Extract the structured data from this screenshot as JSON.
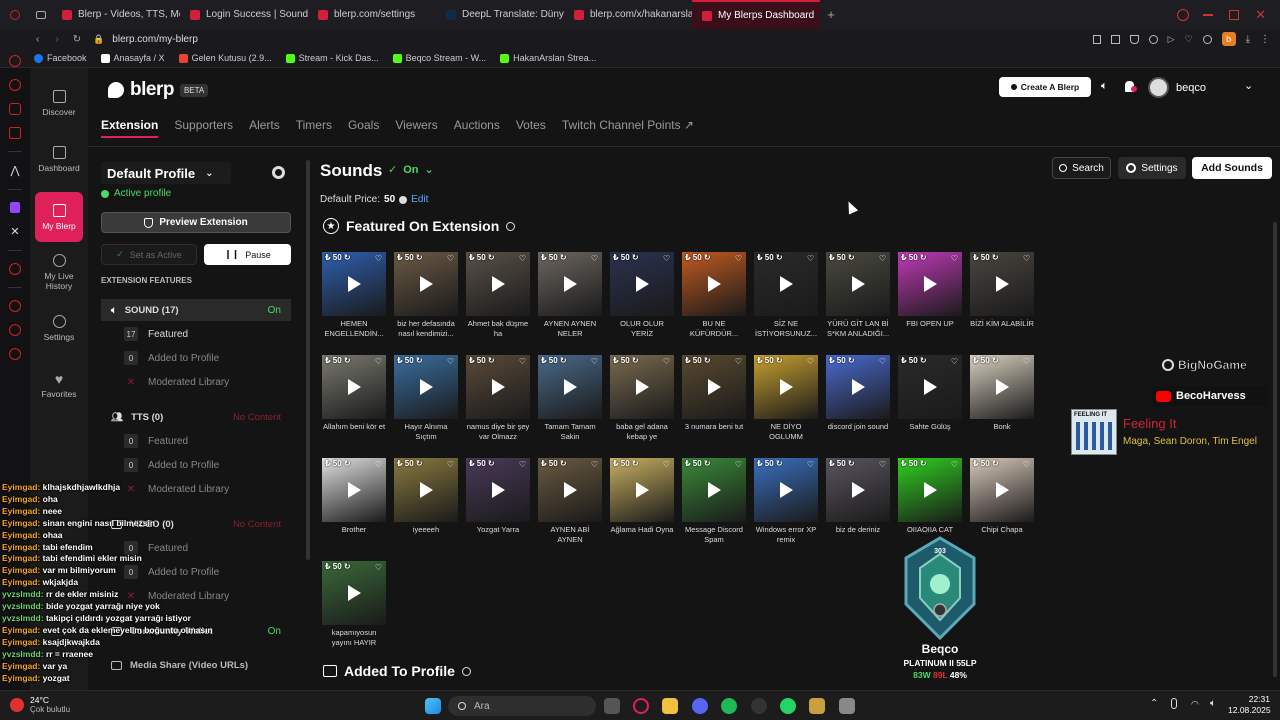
{
  "browser": {
    "tabs": [
      {
        "label": "Blerp - Videos, TTS, Mem",
        "color": "#d0203a"
      },
      {
        "label": "Login Success | Soundbo",
        "color": "#d0203a"
      },
      {
        "label": "blerp.com/settings",
        "color": "#d0203a"
      },
      {
        "label": "DeepL Translate: Dünyan",
        "color": "#0f2b46"
      },
      {
        "label": "blerp.com/x/hakanarslan",
        "color": "#d0203a"
      },
      {
        "label": "My Blerps Dashboard",
        "color": "#d0203a"
      }
    ],
    "url": "blerp.com/my-blerp",
    "bookmarks": [
      {
        "label": "Facebook",
        "color": "#1877f2"
      },
      {
        "label": "Anasayfa / X",
        "color": "#ffffff"
      },
      {
        "label": "Gelen Kutusu (2.9...",
        "color": "#ea4335"
      },
      {
        "label": "Stream - Kick Das...",
        "color": "#53fc18"
      },
      {
        "label": "Beqco Stream - W...",
        "color": "#53fc18"
      },
      {
        "label": "HakanArslan Strea...",
        "color": "#53fc18"
      }
    ]
  },
  "app": {
    "logo": "blerp",
    "beta": "BETA",
    "create_button": "Create A Blerp",
    "username": "beqco",
    "nav": [
      {
        "label": "Discover"
      },
      {
        "label": "Dashboard"
      },
      {
        "label": "My Blerp"
      },
      {
        "label": "My Live History"
      },
      {
        "label": "Settings"
      },
      {
        "label": "Favorites"
      }
    ],
    "tabs": [
      "Extension",
      "Supporters",
      "Alerts",
      "Timers",
      "Goals",
      "Viewers",
      "Auctions",
      "Votes",
      "Twitch Channel Points ↗"
    ]
  },
  "left_panel": {
    "profile": "Default Profile",
    "active_profile": "Active profile",
    "preview": "Preview Extension",
    "set_active": "Set as Active",
    "pause": "Pause",
    "features_heading": "EXTENSION FEATURES",
    "sound": {
      "label": "SOUND (17)",
      "status": "On",
      "featured_count": "17",
      "featured": "Featured",
      "added_count": "0",
      "added": "Added to Profile",
      "moderated": "Moderated Library"
    },
    "tts": {
      "label": "TTS (0)",
      "status": "No Content",
      "featured_count": "0",
      "featured": "Featured",
      "added_count": "0",
      "added": "Added to Profile",
      "moderated": "Moderated Library"
    },
    "video": {
      "label": "VIDEO (0)",
      "status": "No Content",
      "featured_count": "0",
      "featured": "Featured",
      "added_count": "0",
      "added": "Added to Profile",
      "moderated": "Moderated Library"
    },
    "wallet": {
      "label": "Community Wallet",
      "status": "On"
    },
    "media_share": "Media Share (Video URLs)"
  },
  "main": {
    "title": "Sounds",
    "status": "On",
    "default_price_label": "Default Price:",
    "default_price_value": "50",
    "edit": "Edit",
    "search": "Search",
    "settings": "Settings",
    "add_sounds": "Add Sounds",
    "featured_heading": "Featured On Extension",
    "added_heading": "Added To Profile",
    "tiles": [
      {
        "price": "50",
        "caption": "HEMEN ENGELLENDİN...",
        "color": "#2f5fb0"
      },
      {
        "price": "50",
        "caption": "biz her defasında nasıl kendimizi...",
        "color": "#6b5a45"
      },
      {
        "price": "50",
        "caption": "Ahmet bak düşme ha",
        "color": "#5a5148"
      },
      {
        "price": "50",
        "caption": "AYNEN AYNEN NELER YAPIYOR...",
        "color": "#6c6660"
      },
      {
        "price": "50",
        "caption": "OLUR OLUR YERİZ",
        "color": "#2a3250"
      },
      {
        "price": "50",
        "caption": "BU NE KÜFÜRDÜR...",
        "color": "#c25a20"
      },
      {
        "price": "50",
        "caption": "SİZ NE İSTİYORSUNUZ...",
        "color": "#2a2a2a"
      },
      {
        "price": "50",
        "caption": "YÜRÜ GİT LAN Bİ S*KM ANLADIĞI...",
        "color": "#4a4a40"
      },
      {
        "price": "50",
        "caption": "FBI OPEN UP",
        "color": "#c03ab8"
      },
      {
        "price": "50",
        "caption": "BİZİ KİM ALABİLİR",
        "color": "#4a4540"
      },
      {
        "price": "50",
        "caption": "Allahım beni kör et",
        "color": "#7a7a70"
      },
      {
        "price": "50",
        "caption": "Hayır Alnıma Sıçtım",
        "color": "#3a6fa0"
      },
      {
        "price": "50",
        "caption": "namus diye bir şey var Olmazz",
        "color": "#5a4a3a"
      },
      {
        "price": "50",
        "caption": "Tamam Tamam Sakin",
        "color": "#4a6a8a"
      },
      {
        "price": "50",
        "caption": "baba gel adana kebap ye",
        "color": "#7a6a50"
      },
      {
        "price": "50",
        "caption": "3 numara beni tut",
        "color": "#5a4a30"
      },
      {
        "price": "50",
        "caption": "NE DİYO OGLUMM",
        "color": "#c8a030"
      },
      {
        "price": "50",
        "caption": "discord join sound",
        "color": "#4a6ad0"
      },
      {
        "price": "50",
        "caption": "Sahte Gülüş",
        "color": "#2a2a2a"
      },
      {
        "price": "50",
        "caption": "Bonk",
        "color": "#d8d0c0"
      },
      {
        "price": "50",
        "caption": "Brother",
        "color": "#e0e0e0"
      },
      {
        "price": "50",
        "caption": "iyeeeeh",
        "color": "#8a7a40"
      },
      {
        "price": "50",
        "caption": "Yozgat Yarra",
        "color": "#4a3a5a"
      },
      {
        "price": "50",
        "caption": "AYNEN ABİ AYNEN",
        "color": "#6a5a40"
      },
      {
        "price": "50",
        "caption": "Ağlama Hadi Oyna",
        "color": "#c8b060"
      },
      {
        "price": "50",
        "caption": "Message Discord Spam",
        "color": "#3a8a3a"
      },
      {
        "price": "50",
        "caption": "Windows error XP remix",
        "color": "#3a70c0"
      },
      {
        "price": "50",
        "caption": "biz de deriniz",
        "color": "#5a5560"
      },
      {
        "price": "50",
        "caption": "OIIAOIIA CAT",
        "color": "#30d020"
      },
      {
        "price": "50",
        "caption": "Chipi Chapa",
        "color": "#d8c8b8"
      },
      {
        "price": "50",
        "caption": "kapamıyosun yayını HAYIR",
        "color": "#3a6a3a"
      }
    ]
  },
  "overlay": {
    "channel1": "BigNoGame",
    "channel2": "BecoHarvess",
    "song_title": "Feeling It",
    "song_artist": "Maga, Sean Doron, Tim Engel",
    "album_label": "FEELING IT",
    "player_name": "Beqco",
    "rank": "PLATINUM II 55LP",
    "level": "303",
    "wins": "83W",
    "losses": "89L",
    "winrate": "48%",
    "chat": [
      {
        "user": "Eyimgad:",
        "msg": "klhajskdhjawlkdhja",
        "type": "u1"
      },
      {
        "user": "Eyimgad:",
        "msg": "oha",
        "type": "u1"
      },
      {
        "user": "Eyimgad:",
        "msg": "neee",
        "type": "u1"
      },
      {
        "user": "Eyimgad:",
        "msg": "sinan engini nasıl bilmezsin",
        "type": "u1"
      },
      {
        "user": "Eyimgad:",
        "msg": "ohaa",
        "type": "u1"
      },
      {
        "user": "Eyimgad:",
        "msg": "tabi efendim",
        "type": "u1"
      },
      {
        "user": "Eyimgad:",
        "msg": "tabi efendimi ekler misin",
        "type": "u1"
      },
      {
        "user": "Eyimgad:",
        "msg": "var mı bilmiyorum",
        "type": "u1"
      },
      {
        "user": "Eyimgad:",
        "msg": "wkjakjda",
        "type": "u1"
      },
      {
        "user": "yvzslmdd:",
        "msg": "rr de ekler misiniz",
        "type": "u2"
      },
      {
        "user": "yvzslmdd:",
        "msg": "bide yozgat yarrağı niye yok",
        "type": "u2"
      },
      {
        "user": "yvzslmdd:",
        "msg": "takipçi çıldırdı yozgat yarrağı istiyor",
        "type": "u2"
      },
      {
        "user": "Eyimgad:",
        "msg": "evet çok da eklemeyelim boğuntu olmasın",
        "type": "u1"
      },
      {
        "user": "Eyimgad:",
        "msg": "ksajdjkwajkda",
        "type": "u1"
      },
      {
        "user": "yvzslmdd:",
        "msg": "rr = rraenee",
        "type": "u2"
      },
      {
        "user": "Eyimgad:",
        "msg": "var ya",
        "type": "u1"
      },
      {
        "user": "Eyimgad:",
        "msg": "yozgat",
        "type": "u1"
      }
    ]
  },
  "taskbar": {
    "weather_temp": "24°C",
    "weather_desc": "Çok bulutlu",
    "search": "Ara",
    "time": "22:31",
    "date": "12.08.2025"
  }
}
